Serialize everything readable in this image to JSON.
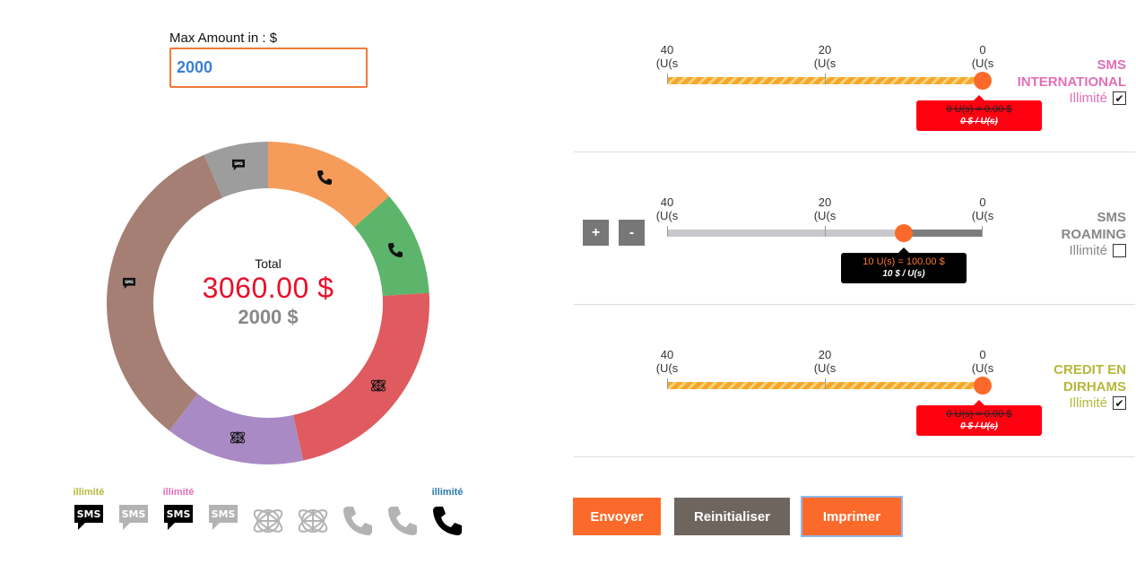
{
  "max_amount": {
    "label": "Max Amount in : $",
    "value": "2000"
  },
  "summary": {
    "total_label": "Total",
    "total_value": "3060.00 $",
    "max_value": "2000 $"
  },
  "donut_segments": [
    {
      "name": "call-orange",
      "color": "#f69c5b",
      "icon": "phone-icon",
      "share": 0.135
    },
    {
      "name": "call-green",
      "color": "#5db56b",
      "icon": "phone-icon",
      "share": 0.105
    },
    {
      "name": "data-red",
      "color": "#df5b5f",
      "icon": "globe-network-icon",
      "share": 0.225
    },
    {
      "name": "data-purple",
      "color": "#a98ac5",
      "icon": "globe-network-icon",
      "share": 0.14
    },
    {
      "name": "sms-brown",
      "color": "#a57f74",
      "icon": "sms-icon",
      "share": 0.33
    },
    {
      "name": "sms-grey",
      "color": "#9d9d9d",
      "icon": "sms-icon",
      "share": 0.065
    }
  ],
  "legend": [
    {
      "tag": "illimité",
      "tag_color": "#b7b73c",
      "icon": "sms-icon",
      "active": true
    },
    {
      "tag": "",
      "tag_color": "",
      "icon": "sms-icon",
      "active": false
    },
    {
      "tag": "illimité",
      "tag_color": "#e070b8",
      "icon": "sms-icon",
      "active": true
    },
    {
      "tag": "",
      "tag_color": "",
      "icon": "sms-icon",
      "active": false
    },
    {
      "tag": "",
      "tag_color": "",
      "icon": "globe-network-icon",
      "active": false
    },
    {
      "tag": "",
      "tag_color": "",
      "icon": "globe-network-icon",
      "active": false
    },
    {
      "tag": "",
      "tag_color": "",
      "icon": "phone-icon",
      "active": false
    },
    {
      "tag": "",
      "tag_color": "",
      "icon": "phone-icon",
      "active": false
    },
    {
      "tag": "illimité",
      "tag_color": "#2a7bb0",
      "icon": "phone-icon",
      "active": true
    }
  ],
  "sms_icon_text": "SMS",
  "sliders": [
    {
      "ticks": [
        {
          "value": "40",
          "unit": "(U(s"
        },
        {
          "value": "20",
          "unit": "(U(s"
        },
        {
          "value": "0",
          "unit": "(U(s"
        }
      ],
      "style": "striped",
      "fraction": 1.0,
      "bubble_style": "red",
      "bubble_line1": "0 U(s) = 0.00 $",
      "bubble_line2": "0 $ / U(s)",
      "title_line1": "SMS",
      "title_line2": "INTERNATIONAL",
      "title_color": "#e070b8",
      "illimite_label": "Illimité",
      "illimite_color": "#e070b8",
      "checked": true
    },
    {
      "ticks": [
        {
          "value": "40",
          "unit": "(U(s"
        },
        {
          "value": "20",
          "unit": "(U(s"
        },
        {
          "value": "0",
          "unit": "(U(s"
        }
      ],
      "style": "grey",
      "fraction": 0.75,
      "bubble_style": "black",
      "bubble_line1": "10 U(s) = 100.00 $",
      "bubble_line2": "10 $ / U(s)",
      "title_line1": "SMS",
      "title_line2": "ROAMING",
      "title_color": "#888888",
      "illimite_label": "Illimité",
      "illimite_color": "#888888",
      "checked": false,
      "plus_label": "+",
      "minus_label": "-"
    },
    {
      "ticks": [
        {
          "value": "40",
          "unit": "(U(s"
        },
        {
          "value": "20",
          "unit": "(U(s"
        },
        {
          "value": "0",
          "unit": "(U(s"
        }
      ],
      "style": "striped",
      "fraction": 1.0,
      "bubble_style": "red",
      "bubble_line1": "0 U(s) = 0.00 $",
      "bubble_line2": "0 $ / U(s)",
      "title_line1": "CREDIT EN",
      "title_line2": "DIRHAMS",
      "title_color": "#b7b73c",
      "illimite_label": "Illimité",
      "illimite_color": "#b7b73c",
      "checked": true
    }
  ],
  "buttons": {
    "send": "Envoyer",
    "reset": "Reinitialiser",
    "print": "Imprimer"
  },
  "colors": {
    "accent_orange": "#fc6a2b",
    "total_red": "#e8102a",
    "brown_button": "#6f655f"
  }
}
